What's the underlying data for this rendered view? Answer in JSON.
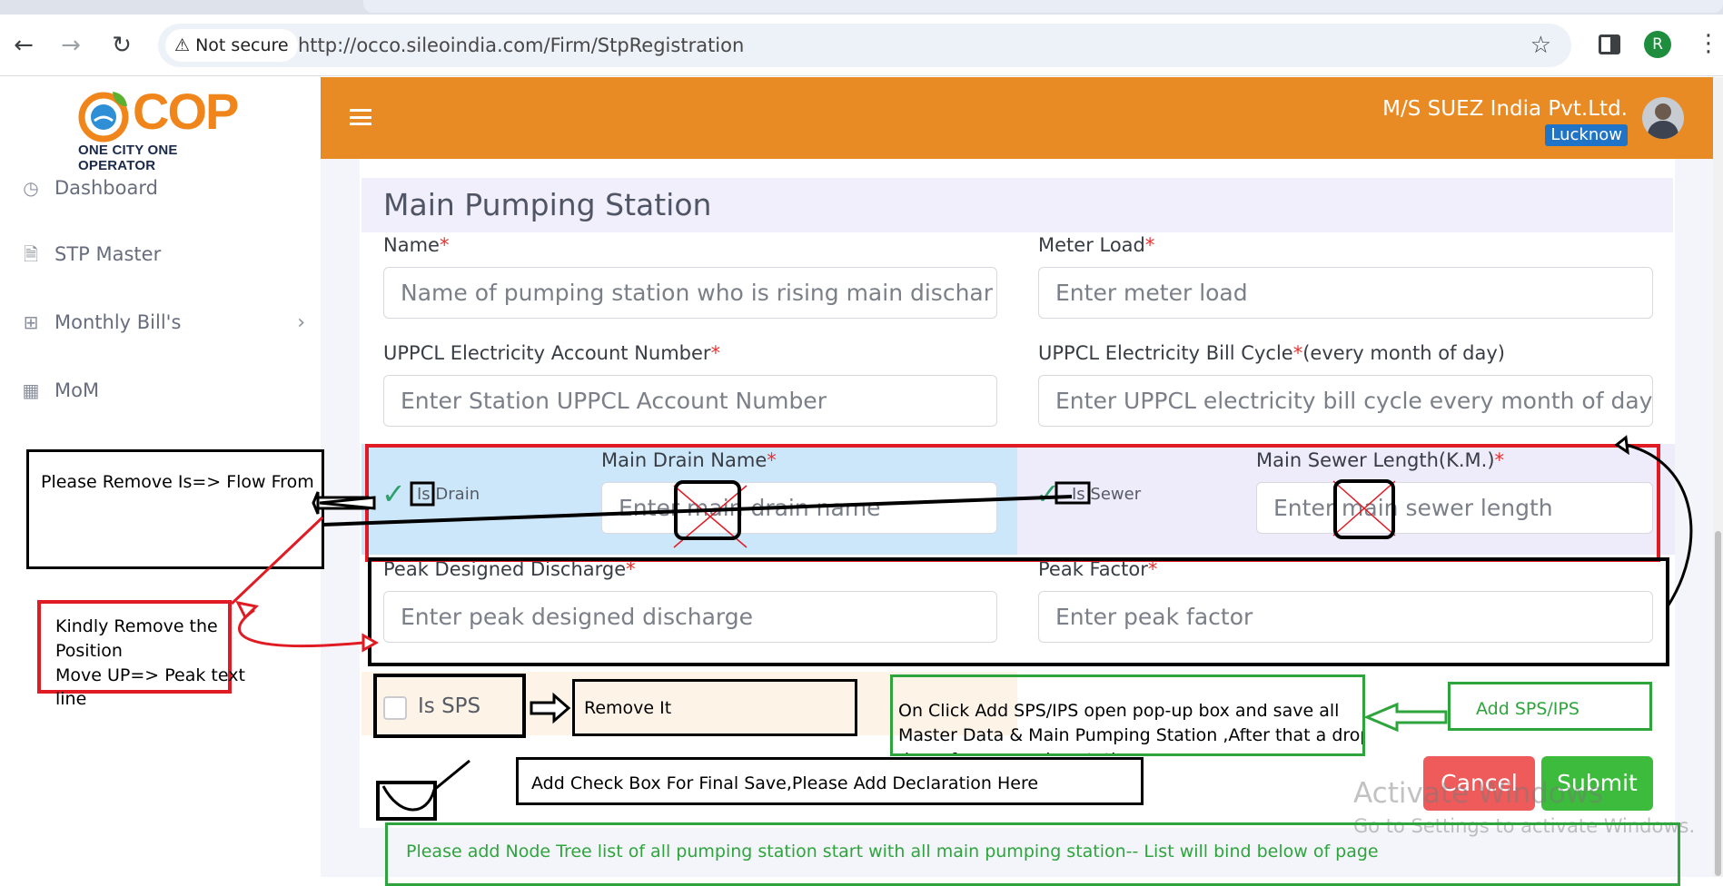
{
  "browser": {
    "security": "Not secure",
    "url": "http://occo.sileoindia.com/Firm/StpRegistration",
    "profile_initial": "R"
  },
  "sidebar": {
    "logo_text": "COP",
    "logo_subtitle": "ONE CITY ONE OPERATOR",
    "items": [
      {
        "label": "Dashboard",
        "icon": "gauge-icon"
      },
      {
        "label": "STP Master",
        "icon": "document-icon"
      },
      {
        "label": "Monthly Bill's",
        "icon": "table-icon"
      },
      {
        "label": "MoM",
        "icon": "grid-icon"
      }
    ]
  },
  "header": {
    "firm": "M/S SUEZ India Pvt.Ltd.",
    "city": "Lucknow"
  },
  "form": {
    "section_title": "Main Pumping Station",
    "name_label": "Name",
    "name_placeholder": "Name of pumping station who is  rising  main dischar",
    "meter_label": "Meter Load",
    "meter_placeholder": "Enter meter load",
    "uppcl_account_label": "UPPCL Electricity Account Number",
    "uppcl_account_placeholder": "Enter Station UPPCL Account Number",
    "uppcl_cycle_label": "UPPCL Electricity Bill Cycle",
    "uppcl_cycle_suffix": "(every month of day)",
    "uppcl_cycle_placeholder": "Enter UPPCL electricity bill cycle every month of day",
    "is_drain_label": "Is Drain",
    "drain_name_label": "Main Drain Name",
    "drain_name_placeholder": "Enter main drain name",
    "is_sewer_label": "Is Sewer",
    "sewer_length_label": "Main Sewer Length(K.M.)",
    "sewer_length_placeholder": "Enter main sewer length",
    "peak_discharge_label": "Peak Designed Discharge",
    "peak_discharge_placeholder": "Enter peak designed discharge",
    "peak_factor_label": "Peak Factor",
    "peak_factor_placeholder": "Enter peak factor",
    "is_sps_label": "Is SPS",
    "required_mark": "*",
    "cancel": "Cancel",
    "submit": "Submit"
  },
  "watermark": {
    "line1": "Activate Windows",
    "line2": "Go to Settings to activate Windows."
  },
  "annotations": {
    "remove_is_flow": "Please Remove Is=> Flow From",
    "kindly_remove": [
      "Kindly Remove the",
      "Position",
      "Move UP=> Peak text",
      "line"
    ],
    "remove_it": "Remove It",
    "on_click": [
      "On Click Add SPS/IPS open pop-up box and save all",
      "Master Data & Main Pumping Station ,After that a drop-",
      "down from pumping station"
    ],
    "add_sps": "Add SPS/IPS",
    "add_checkbox": "Add Check Box For Final Save,Please Add Declaration Here",
    "node_tree": "Please add Node Tree list of all pumping station start with all main pumping station-- List will bind below of page"
  }
}
